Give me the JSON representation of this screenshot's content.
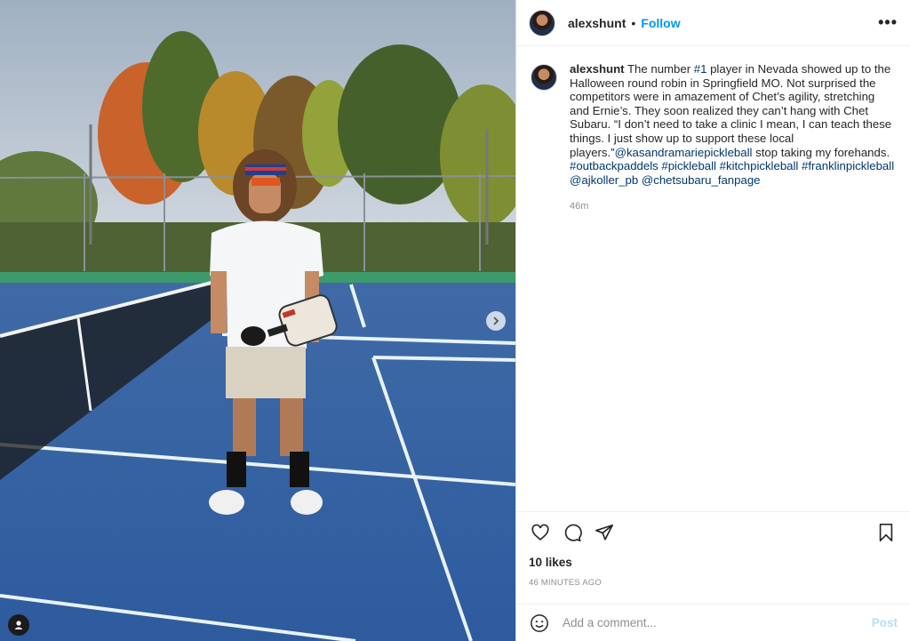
{
  "header": {
    "username": "alexshunt",
    "separator": "•",
    "follow_label": "Follow",
    "more_icon": "more-horizontal-icon"
  },
  "caption": {
    "username": "alexshunt",
    "text_1": " The number ",
    "tag_1": "#1",
    "text_2": " player in Nevada showed up to the Halloween round robin in Springfield MO. Not surprised the competitors were in amazement of Chet’s agility, stretching and Ernie’s. They soon realized they can’t hang with Chet Subaru. “I don’t need to take a clinic I mean, I can teach these things. I just show up to support these local players.”",
    "mention_1": "@kasandramariepickleball",
    "text_3": " stop taking my forehands. ",
    "hashtag_1": "#outbackpaddels",
    "hashtag_2": "#pickleball",
    "hashtag_3": "#kitchpickleball",
    "hashtag_4": "#franklinpickleball",
    "mention_2": "@ajkoller_pb",
    "mention_3": "@chetsubaru_fanpage",
    "time": "46m"
  },
  "actions": {
    "like_icon": "heart-icon",
    "comment_icon": "comment-icon",
    "share_icon": "share-icon",
    "save_icon": "bookmark-icon"
  },
  "likes": "10 likes",
  "timestamp": "46 MINUTES AGO",
  "add_comment": {
    "placeholder": "Add a comment...",
    "post_label": "Post",
    "emoji_icon": "emoji-icon"
  },
  "media": {
    "next_icon": "chevron-right-icon",
    "user_tag_icon": "user-tag-icon"
  },
  "colors": {
    "link_blue": "#0095f6",
    "hashtag_blue": "#00376b",
    "muted": "#8e8e8e",
    "post_disabled": "#b2dffc",
    "court_blue": "#2f5e9f"
  }
}
